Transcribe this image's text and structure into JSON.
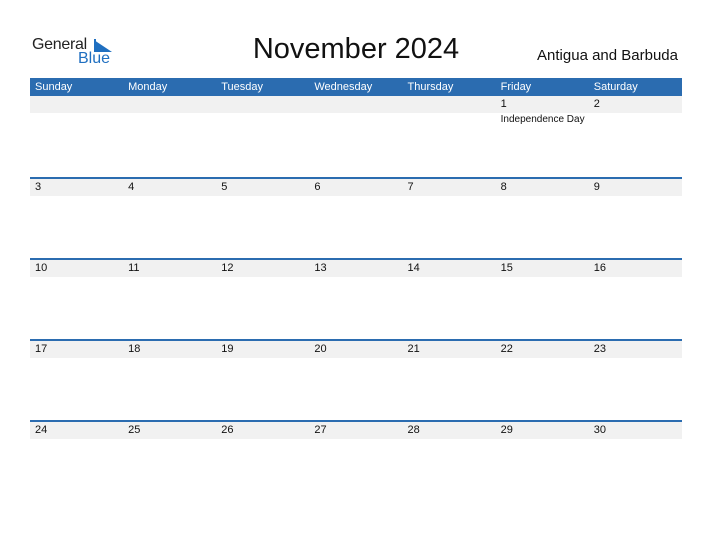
{
  "logo": {
    "text_general": "General",
    "text_blue": "Blue"
  },
  "title": "November 2024",
  "country": "Antigua and Barbuda",
  "colors": {
    "accent": "#2b6cb0",
    "band": "#f1f1f1"
  },
  "weekdays": [
    "Sunday",
    "Monday",
    "Tuesday",
    "Wednesday",
    "Thursday",
    "Friday",
    "Saturday"
  ],
  "weeks": [
    [
      {
        "date": ""
      },
      {
        "date": ""
      },
      {
        "date": ""
      },
      {
        "date": ""
      },
      {
        "date": ""
      },
      {
        "date": "1",
        "holiday": "Independence Day"
      },
      {
        "date": "2"
      }
    ],
    [
      {
        "date": "3"
      },
      {
        "date": "4"
      },
      {
        "date": "5"
      },
      {
        "date": "6"
      },
      {
        "date": "7"
      },
      {
        "date": "8"
      },
      {
        "date": "9"
      }
    ],
    [
      {
        "date": "10"
      },
      {
        "date": "11"
      },
      {
        "date": "12"
      },
      {
        "date": "13"
      },
      {
        "date": "14"
      },
      {
        "date": "15"
      },
      {
        "date": "16"
      }
    ],
    [
      {
        "date": "17"
      },
      {
        "date": "18"
      },
      {
        "date": "19"
      },
      {
        "date": "20"
      },
      {
        "date": "21"
      },
      {
        "date": "22"
      },
      {
        "date": "23"
      }
    ],
    [
      {
        "date": "24"
      },
      {
        "date": "25"
      },
      {
        "date": "26"
      },
      {
        "date": "27"
      },
      {
        "date": "28"
      },
      {
        "date": "29"
      },
      {
        "date": "30"
      }
    ]
  ]
}
